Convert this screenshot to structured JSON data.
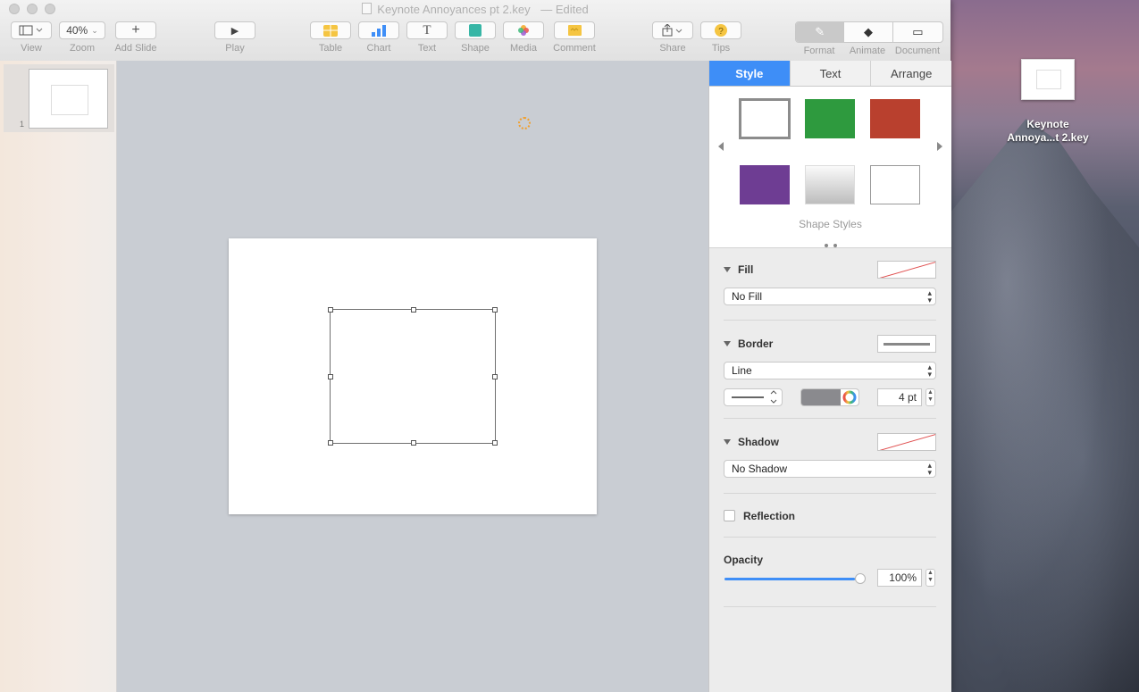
{
  "window": {
    "title": "Keynote Annoyances pt 2.key",
    "status": "Edited"
  },
  "toolbar": {
    "view_label": "View",
    "zoom_value": "40%",
    "zoom_label": "Zoom",
    "add_slide_label": "Add Slide",
    "play_label": "Play",
    "table_label": "Table",
    "chart_label": "Chart",
    "text_label": "Text",
    "shape_label": "Shape",
    "media_label": "Media",
    "comment_label": "Comment",
    "share_label": "Share",
    "tips_label": "Tips",
    "format_label": "Format",
    "animate_label": "Animate",
    "document_label": "Document"
  },
  "navigator": {
    "slides": [
      {
        "number": "1"
      }
    ]
  },
  "inspector": {
    "tabs": [
      "Style",
      "Text",
      "Arrange"
    ],
    "active_tab": "Style",
    "shape_styles_label": "Shape Styles",
    "shape_style_colors": [
      "#ffffff",
      "#2e9a3e",
      "#b9402e",
      "#6e3d93",
      "#d9d9d9",
      "#ffffff"
    ],
    "fill": {
      "label": "Fill",
      "value": "No Fill"
    },
    "border": {
      "label": "Border",
      "value": "Line",
      "width": "4 pt",
      "color": "#8a8a8e"
    },
    "shadow": {
      "label": "Shadow",
      "value": "No Shadow"
    },
    "reflection": {
      "label": "Reflection",
      "checked": false
    },
    "opacity": {
      "label": "Opacity",
      "value": "100%",
      "fraction": 1.0
    }
  },
  "desktop": {
    "file_icon_label_line1": "Keynote",
    "file_icon_label_line2": "Annoya...t 2.key"
  },
  "colors": {
    "accent": "#3e8ef7",
    "canvas_bg": "#c9cdd3"
  }
}
